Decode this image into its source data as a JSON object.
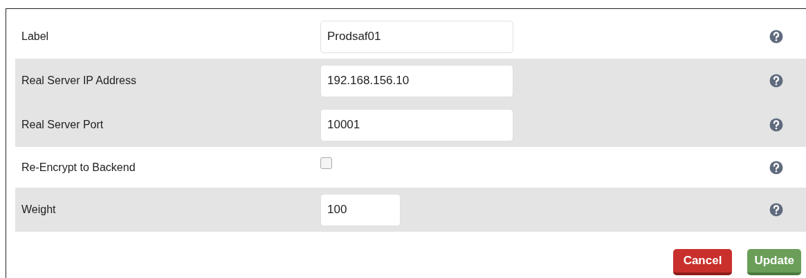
{
  "rows": [
    {
      "label": "Label",
      "kind": "text",
      "value": "Prodsaf01",
      "shaded": false
    },
    {
      "label": "Real Server IP Address",
      "kind": "text",
      "value": "192.168.156.10",
      "shaded": true
    },
    {
      "label": "Real Server Port",
      "kind": "text",
      "value": "10001",
      "shaded": true
    },
    {
      "label": "Re-Encrypt to Backend",
      "kind": "checkbox",
      "checked": false,
      "shaded": false
    },
    {
      "label": "Weight",
      "kind": "short_text",
      "value": "100",
      "shaded": true
    }
  ],
  "buttons": [
    {
      "label": "Cancel",
      "kind": "danger"
    },
    {
      "label": "Update",
      "kind": "success"
    }
  ]
}
